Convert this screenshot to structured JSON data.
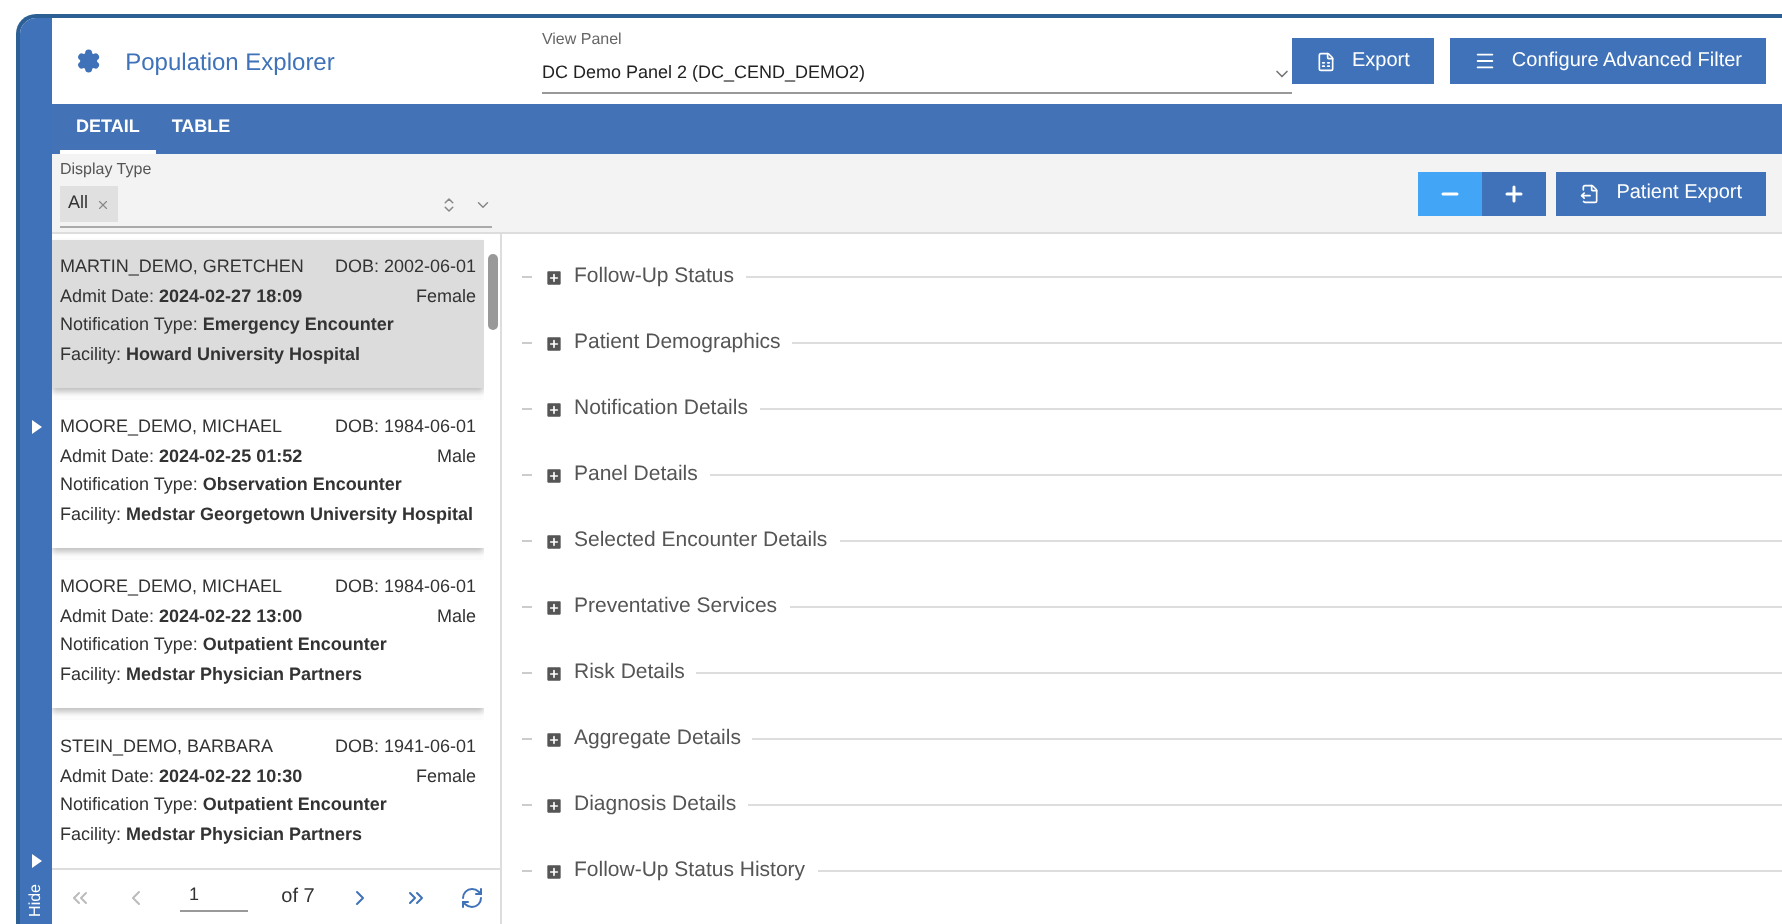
{
  "header": {
    "title": "Population Explorer",
    "view_panel": {
      "label": "View Panel",
      "value": "DC Demo Panel 2 (DC_CEND_DEMO2)"
    },
    "buttons": [
      "Export",
      "Configure Advanced Filter"
    ]
  },
  "tabs": [
    {
      "label": "DETAIL",
      "selected": true
    },
    {
      "label": "TABLE",
      "selected": false
    }
  ],
  "display_type": {
    "label": "Display Type",
    "tags": [
      "All"
    ]
  },
  "toolbar": {
    "patient_export": "Patient Export"
  },
  "sidebar": {
    "hide_label": "Hide"
  },
  "patients": [
    {
      "name": "MARTIN_DEMO, GRETCHEN",
      "dob": "DOB: 2002-06-01",
      "admit": "Admit Date: **2024-02-27 18:09**",
      "gender": "Female",
      "notification": "Notification Type: **Emergency Encounter**",
      "facility": "Facility: **Howard University Hospital**",
      "selected": true
    },
    {
      "name": "MOORE_DEMO, MICHAEL",
      "dob": "DOB: 1984-06-01",
      "admit": "Admit Date: **2024-02-25 01:52**",
      "gender": "Male",
      "notification": "Notification Type: **Observation Encounter**",
      "facility": "Facility: **Medstar Georgetown University Hospital**",
      "selected": false
    },
    {
      "name": "MOORE_DEMO, MICHAEL",
      "dob": "DOB: 1984-06-01",
      "admit": "Admit Date: **2024-02-22 13:00**",
      "gender": "Male",
      "notification": "Notification Type: **Outpatient Encounter**",
      "facility": "Facility: **Medstar Physician Partners**",
      "selected": false
    },
    {
      "name": "STEIN_DEMO, BARBARA",
      "dob": "DOB: 1941-06-01",
      "admit": "Admit Date: **2024-02-22 10:30**",
      "gender": "Female",
      "notification": "Notification Type: **Outpatient Encounter**",
      "facility": "Facility: **Medstar Physician Partners**",
      "selected": false
    }
  ],
  "pager": {
    "page": "1",
    "total": "of 7"
  },
  "sections": [
    {
      "title": "Follow-Up Status",
      "expanded": false
    },
    {
      "title": "Patient Demographics",
      "expanded": false
    },
    {
      "title": "Notification Details",
      "expanded": false
    },
    {
      "title": "Panel Details",
      "expanded": false
    },
    {
      "title": "Selected Encounter Details",
      "expanded": false
    },
    {
      "title": "Preventative Services",
      "expanded": false
    },
    {
      "title": "Risk Details",
      "expanded": false
    },
    {
      "title": "Aggregate Details",
      "expanded": false
    },
    {
      "title": "Diagnosis Details",
      "expanded": false
    },
    {
      "title": "Follow-Up Status History",
      "expanded": false
    }
  ]
}
